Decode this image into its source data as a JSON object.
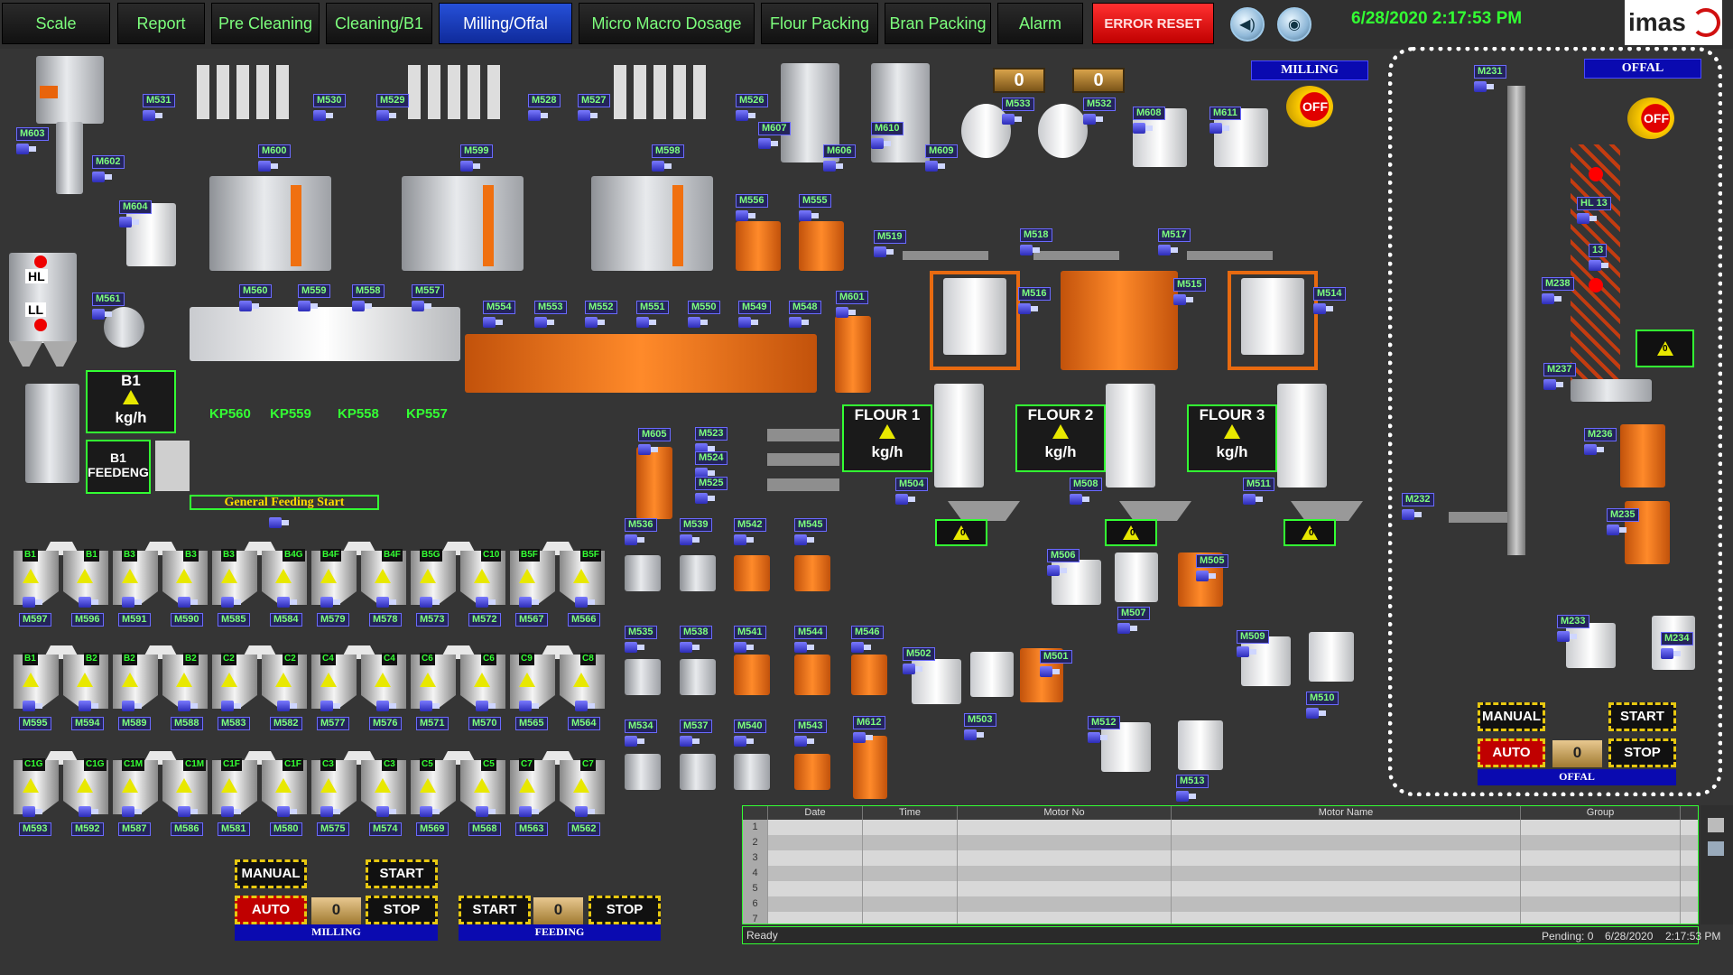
{
  "tabs": [
    {
      "label": "Scale"
    },
    {
      "label": "Report"
    },
    {
      "label": "Pre Cleaning"
    },
    {
      "label": "Cleaning/B1"
    },
    {
      "label": "Milling/Offal",
      "active": true
    },
    {
      "label": "Micro Macro Dosage"
    },
    {
      "label": "Flour Packing"
    },
    {
      "label": "Bran Packing"
    },
    {
      "label": "Alarm"
    },
    {
      "label": "ERROR RESET"
    }
  ],
  "clock": "6/28/2020 2:17:53 PM",
  "logo": "imas",
  "motors_top": [
    "M603",
    "M602",
    "M604",
    "M561",
    "M531",
    "M530",
    "M529",
    "M528",
    "M527",
    "M526",
    "M600",
    "M599",
    "M598",
    "M607",
    "M606",
    "M610",
    "M609",
    "M533",
    "M532",
    "M608",
    "M611",
    "M556",
    "M555",
    "M519",
    "M518",
    "M517",
    "M516",
    "M515",
    "M514",
    "M601",
    "M560",
    "M559",
    "M558",
    "M557",
    "M554",
    "M553",
    "M552",
    "M551",
    "M550",
    "M549",
    "M548"
  ],
  "counters": {
    "c1": "0",
    "c2": "0"
  },
  "milling_header": "MILLING",
  "offal_header": "OFFAL",
  "off_label": "OFF",
  "hl": "HL",
  "ll": "LL",
  "b1": {
    "title": "B1",
    "unit": "kg/h",
    "feed": "B1 FEEDENG"
  },
  "kp": [
    "KP560",
    "KP559",
    "KP558",
    "KP557"
  ],
  "general_feed": "General Feeding Start",
  "flour": [
    {
      "title": "FLOUR 1",
      "unit": "kg/h"
    },
    {
      "title": "FLOUR 2",
      "unit": "kg/h"
    },
    {
      "title": "FLOUR 3",
      "unit": "kg/h"
    }
  ],
  "feed_motors": [
    "M605",
    "M523",
    "M524",
    "M525",
    "M504",
    "M508",
    "M511"
  ],
  "warn_counts": [
    "0",
    "0",
    "0",
    "0"
  ],
  "bottom_motors": [
    "M536",
    "M539",
    "M542",
    "M545",
    "M535",
    "M538",
    "M541",
    "M544",
    "M546",
    "M534",
    "M537",
    "M540",
    "M543",
    "M612",
    "M502",
    "M503",
    "M501",
    "M506",
    "M507",
    "M505",
    "M509",
    "M510",
    "M512",
    "M513"
  ],
  "offal_motors": [
    "M231",
    "HL 13",
    "13",
    "M238",
    "M237",
    "M236",
    "M235",
    "M232",
    "M233",
    "M234"
  ],
  "cells_row1": [
    {
      "l1": "B1",
      "l2": "B1",
      "t1": "M597",
      "t2": "M596"
    },
    {
      "l1": "B3",
      "l2": "B3",
      "t1": "M591",
      "t2": "M590"
    },
    {
      "l1": "B3",
      "l2": "B4G",
      "t1": "M585",
      "t2": "M584"
    },
    {
      "l1": "B4F",
      "l2": "B4F",
      "t1": "M579",
      "t2": "M578"
    },
    {
      "l1": "B5G",
      "l2": "C10",
      "t1": "M573",
      "t2": "M572"
    },
    {
      "l1": "B5F",
      "l2": "B5F",
      "t1": "M567",
      "t2": "M566"
    }
  ],
  "cells_row2": [
    {
      "l1": "B1",
      "l2": "B2",
      "t1": "M595",
      "t2": "M594"
    },
    {
      "l1": "B2",
      "l2": "B2",
      "t1": "M589",
      "t2": "M588"
    },
    {
      "l1": "C2",
      "l2": "C2",
      "t1": "M583",
      "t2": "M582"
    },
    {
      "l1": "C4",
      "l2": "C4",
      "t1": "M577",
      "t2": "M576"
    },
    {
      "l1": "C6",
      "l2": "C6",
      "t1": "M571",
      "t2": "M570"
    },
    {
      "l1": "C9",
      "l2": "C8",
      "t1": "M565",
      "t2": "M564"
    }
  ],
  "cells_row3": [
    {
      "l1": "C1G",
      "l2": "C1G",
      "t1": "M593",
      "t2": "M592"
    },
    {
      "l1": "C1M",
      "l2": "C1M",
      "t1": "M587",
      "t2": "M586"
    },
    {
      "l1": "C1F",
      "l2": "C1F",
      "t1": "M581",
      "t2": "M580"
    },
    {
      "l1": "C3",
      "l2": "C3",
      "t1": "M575",
      "t2": "M574"
    },
    {
      "l1": "C5",
      "l2": "C5",
      "t1": "M569",
      "t2": "M568"
    },
    {
      "l1": "C7",
      "l2": "C7",
      "t1": "M563",
      "t2": "M562"
    }
  ],
  "controls": {
    "manual": "MANUAL",
    "auto": "AUTO",
    "start": "START",
    "stop": "STOP",
    "count": "0",
    "milling": "MILLING",
    "feeding": "FEEDING",
    "offal": "OFFAL"
  },
  "table": {
    "columns": [
      "Date",
      "Time",
      "Motor No",
      "Motor Name",
      "Group"
    ],
    "rows": [
      "1",
      "2",
      "3",
      "4",
      "5",
      "6",
      "7"
    ]
  },
  "status": {
    "left": "Ready",
    "pending": "Pending: 0",
    "date": "6/28/2020",
    "time": "2:17:53 PM"
  }
}
